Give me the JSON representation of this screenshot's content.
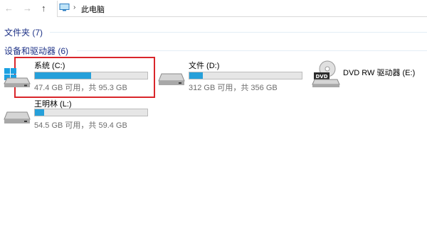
{
  "nav": {
    "back_icon": "back-arrow-icon",
    "back_glyph": "←",
    "forward_icon": "forward-arrow-icon",
    "forward_glyph": "→",
    "up_icon": "up-arrow-icon",
    "up_glyph": "↑",
    "breadcrumb": [
      "此电脑"
    ],
    "breadcrumb_sep": "›"
  },
  "groups": {
    "folders": {
      "label": "文件夹 (7)",
      "collapsed": true
    },
    "devices": {
      "label": "设备和驱动器 (6)",
      "collapsed": false
    }
  },
  "drives": [
    {
      "name": "系统 (C:)",
      "info": "47.4 GB 可用，共 95.3 GB",
      "used_fraction": 0.5,
      "icon": "windows-drive-icon",
      "selected": true
    },
    {
      "name": "文件 (D:)",
      "info": "312 GB 可用，共 356 GB",
      "used_fraction": 0.12,
      "icon": "hard-drive-icon"
    },
    {
      "name": "DVD RW 驱动器 (E:)",
      "info": "",
      "icon": "dvd-drive-icon"
    },
    {
      "name": "王明林 (L:)",
      "info": "54.5 GB 可用，共 59.4 GB",
      "used_fraction": 0.08,
      "icon": "hard-drive-icon"
    }
  ],
  "colors": {
    "bar_fill": "#26a0da",
    "header_text": "#1e3287",
    "highlight": "#d9262b"
  }
}
